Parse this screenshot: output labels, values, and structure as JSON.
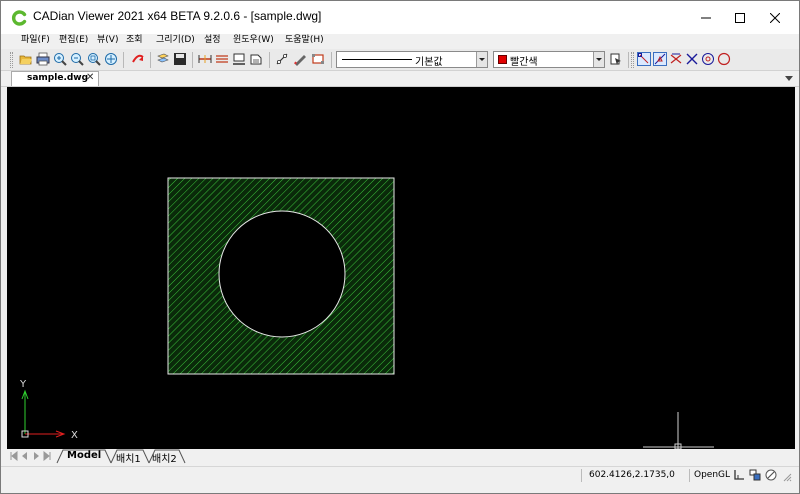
{
  "window": {
    "title": "CADian Viewer 2021 x64 BETA 9.2.0.6 - [sample.dwg]"
  },
  "menus": [
    "파일(F)",
    "편집(E)",
    "뷰(V)",
    "조회",
    "그리기(D)",
    "설정",
    "윈도우(W)",
    "도움말(H)"
  ],
  "toolbar": {
    "linetype_value": "기본값",
    "color_value": "빨간색",
    "color_swatch": "#e00000"
  },
  "tab": {
    "label": "sample.dwg",
    "close": "✕"
  },
  "canvas": {
    "axis_y": "Y",
    "axis_x": "X",
    "hatch_color": "#3cc43c",
    "background": "#000000"
  },
  "layouts": [
    "Model",
    "배치1",
    "배치2"
  ],
  "status": {
    "coords": "602.4126,2.1735,0",
    "renderer": "OpenGL"
  },
  "icons": {
    "app": "cadian-logo-icon",
    "minimize": "minimize-icon",
    "maximize": "maximize-icon",
    "close": "close-icon"
  }
}
